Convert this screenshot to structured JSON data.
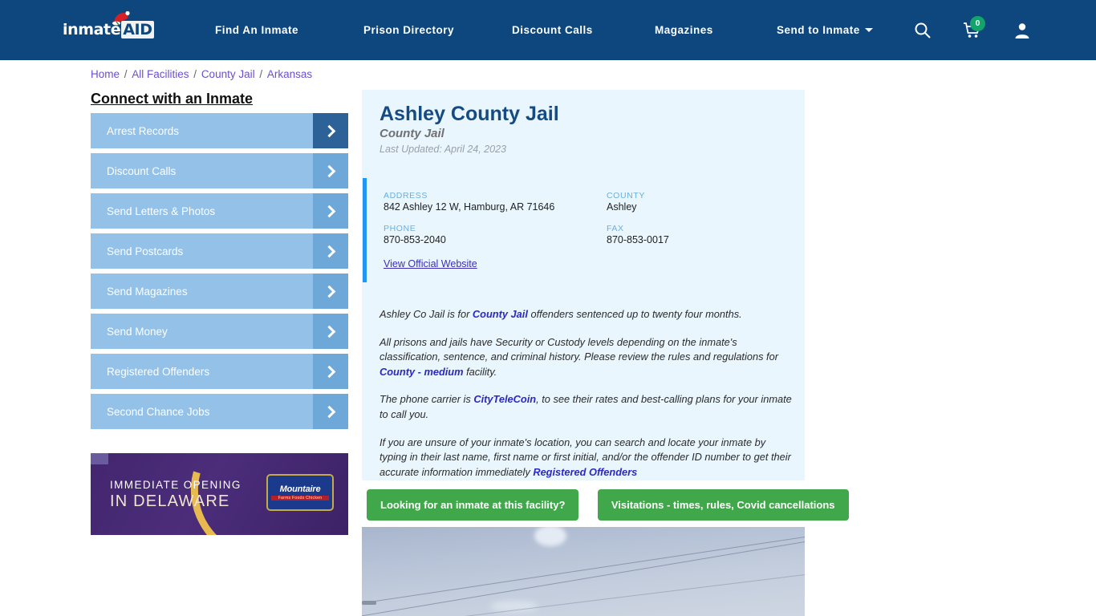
{
  "header": {
    "logo_text_1": "inmate",
    "logo_text_2": "AID",
    "nav": [
      {
        "label": "Find An Inmate"
      },
      {
        "label": "Prison Directory"
      },
      {
        "label": "Discount Calls"
      },
      {
        "label": "Magazines"
      },
      {
        "label": "Send to Inmate"
      }
    ],
    "cart_count": "0",
    "icons": {
      "search": "search-icon",
      "cart": "cart-icon",
      "user": "user-icon"
    },
    "accent_color": "#0e477d",
    "badge_color": "#12a46b"
  },
  "breadcrumb": {
    "items": [
      "Home",
      "All Facilities",
      "County Jail",
      "Arkansas"
    ],
    "separator": "/"
  },
  "sidebar": {
    "title": "Connect with an Inmate",
    "items": [
      {
        "label": "Arrest Records"
      },
      {
        "label": "Discount Calls"
      },
      {
        "label": "Send Letters & Photos"
      },
      {
        "label": "Send Postcards"
      },
      {
        "label": "Send Magazines"
      },
      {
        "label": "Send Money"
      },
      {
        "label": "Registered Offenders"
      },
      {
        "label": "Second Chance Jobs"
      }
    ],
    "ad": {
      "line1": "IMMEDIATE OPENING",
      "line2": "IN DELAWARE",
      "logo_top": "Mountaire",
      "logo_bottom": "Farms Foods Chicken"
    }
  },
  "facility": {
    "name": "Ashley County Jail",
    "type": "County Jail",
    "last_updated": "Last Updated: April 24, 2023",
    "info": {
      "address_label": "ADDRESS",
      "address_value": "842 Ashley 12 W, Hamburg, AR 71646",
      "county_label": "COUNTY",
      "county_value": "Ashley",
      "phone_label": "PHONE",
      "phone_value": "870-853-2040",
      "fax_label": "FAX",
      "fax_value": "870-853-0017",
      "website_link": "View Official Website"
    },
    "description": {
      "p1_a": "Ashley Co Jail is for ",
      "p1_link": "County Jail",
      "p1_b": " offenders sentenced up to twenty four months.",
      "p2_a": "All prisons and jails have Security or Custody levels depending on the inmate's classification, sentence, and criminal history. Please review the rules and regulations for ",
      "p2_link": "County - medium",
      "p2_b": " facility.",
      "p3_a": "The phone carrier is ",
      "p3_link": "CityTeleCoin",
      "p3_b": ", to see their rates and best-calling plans for your inmate to call you.",
      "p4_a": "If you are unsure of your inmate's location, you can search and locate your inmate by typing in their last name, first name or first initial, and/or the offender ID number to get their accurate information immediately ",
      "p4_link": "Registered Offenders"
    },
    "buttons": [
      {
        "label": "Looking for an inmate at this facility?"
      },
      {
        "label": "Visitations - times, rules, Covid cancellations"
      }
    ],
    "button_color": "#40a74b"
  }
}
